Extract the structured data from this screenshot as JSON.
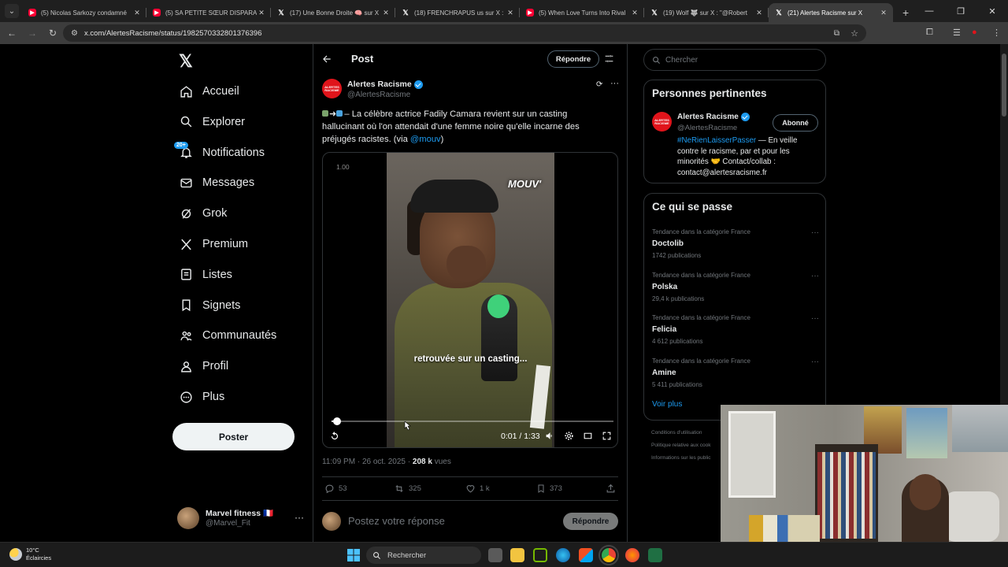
{
  "browser": {
    "tabs": [
      {
        "label": "(5) Nicolas Sarkozy condamné",
        "kind": "yt"
      },
      {
        "label": "(5) SA PETITE SŒUR DISPARAÎT",
        "kind": "yt"
      },
      {
        "label": "(17) Une Bonne Droite 🧠 sur X",
        "kind": "x"
      },
      {
        "label": "(18) FRENCHRAPUS us sur X : \"",
        "kind": "x"
      },
      {
        "label": "(5) When Love Turns Into Rival",
        "kind": "yt"
      },
      {
        "label": "(19) Wolf 🐺 sur X : \"@Robert",
        "kind": "x"
      },
      {
        "label": "(21) Alertes Racisme sur X",
        "kind": "x",
        "active": true
      }
    ],
    "url": "x.com/AlertesRacisme/status/1982570332801376396"
  },
  "nav": {
    "items": [
      {
        "label": "Accueil",
        "icon": "home-icon"
      },
      {
        "label": "Explorer",
        "icon": "search-icon"
      },
      {
        "label": "Notifications",
        "icon": "bell-icon",
        "badge": "20+"
      },
      {
        "label": "Messages",
        "icon": "envelope-icon"
      },
      {
        "label": "Grok",
        "icon": "grok-icon"
      },
      {
        "label": "Premium",
        "icon": "x-logo-icon"
      },
      {
        "label": "Listes",
        "icon": "list-icon"
      },
      {
        "label": "Signets",
        "icon": "bookmark-icon"
      },
      {
        "label": "Communautés",
        "icon": "communities-icon"
      },
      {
        "label": "Profil",
        "icon": "person-icon"
      },
      {
        "label": "Plus",
        "icon": "more-circle-icon"
      }
    ],
    "post_label": "Poster",
    "account": {
      "name": "Marvel fitness 🇫🇷",
      "handle": "@Marvel_Fit"
    }
  },
  "header": {
    "title": "Post",
    "reply_label": "Répondre"
  },
  "post": {
    "avatar_text": "ALERTES RACISME",
    "author": "Alertes Racisme",
    "handle": "@AlertesRacisme",
    "text_before": "– La célèbre actrice Fadily Camara revient sur un casting hallucinant où l'on attendait d'une femme noire qu'elle incarne des préjugés racistes. (via ",
    "mention": "@mouv",
    "text_after": ")",
    "video": {
      "speed": "1.00",
      "logo": "MOUV'",
      "subtitle": "retrouvée sur un casting...",
      "time": "0:01 / 1:33",
      "progress": 0.011
    },
    "timestamp": "11:09 PM · 26 oct. 2025 · ",
    "views": "208 k",
    "views_label": " vues",
    "stats": {
      "replies": "53",
      "reposts": "325",
      "likes": "1 k",
      "bookmarks": "373"
    },
    "compose_placeholder": "Postez votre réponse",
    "compose_button": "Répondre"
  },
  "right": {
    "search_placeholder": "Chercher",
    "people_title": "Personnes pertinentes",
    "person": {
      "name": "Alertes Racisme",
      "handle": "@AlertesRacisme",
      "button": "Abonné",
      "hashtag": "#NeRienLaisserPasser",
      "bio": " — En veille contre le racisme, par et pour les minorités 🤝 Contact/collab : contact@alertesracisme.fr"
    },
    "trends_title": "Ce qui se passe",
    "trends": [
      {
        "category": "Tendance dans la catégorie France",
        "name": "Doctolib",
        "posts": "1742 publications"
      },
      {
        "category": "Tendance dans la catégorie France",
        "name": "Polska",
        "posts": "29,4 k publications"
      },
      {
        "category": "Tendance dans la catégorie France",
        "name": "Felicia",
        "posts": "4 612 publications"
      },
      {
        "category": "Tendance dans la catégorie France",
        "name": "Amine",
        "posts": "5 411 publications"
      }
    ],
    "see_more": "Voir plus",
    "footer": [
      "Conditions d'utilisation",
      "Politique relative aux cook",
      "Informations sur les public"
    ]
  },
  "taskbar": {
    "temp": "10°C",
    "weather": "Éclaircies",
    "search": "Rechercher"
  }
}
